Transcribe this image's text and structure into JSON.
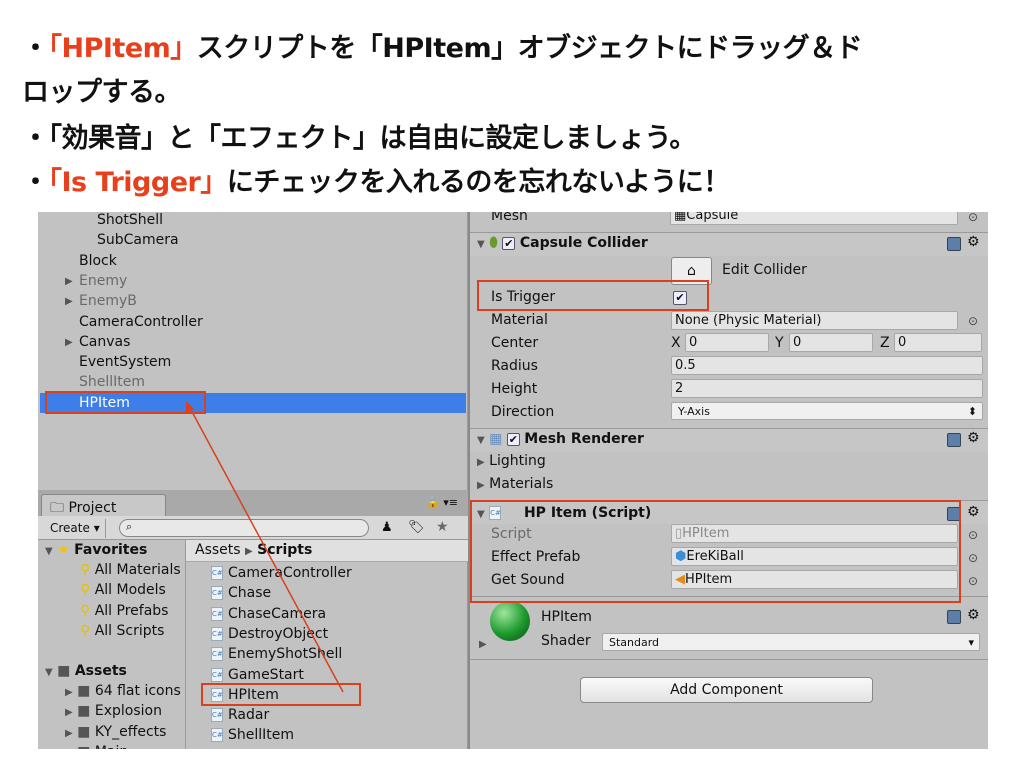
{
  "slide": {
    "lines": [
      {
        "bullet": "・",
        "parts": [
          {
            "text": "「HPItem」",
            "red": true
          },
          {
            "text": "スクリプトを「HPItem」オブジェクトにドラッグ＆ド",
            "red": false
          }
        ]
      },
      {
        "bullet": "",
        "parts": [
          {
            "text": "ロップする。",
            "red": false
          }
        ]
      },
      {
        "bullet": "・",
        "parts": [
          {
            "text": "「効果音」と「エフェクト」は自由に設定しましょう。",
            "red": false
          }
        ]
      },
      {
        "bullet": "・",
        "parts": [
          {
            "text": "「Is Trigger」",
            "red": true
          },
          {
            "text": "にチェックを入れるのを忘れないように！",
            "red": false
          }
        ]
      }
    ],
    "accent": "#e8401c"
  },
  "hierarchy": {
    "items": [
      {
        "label": "ShotShell",
        "indent": 2,
        "gray": false,
        "arrow": false
      },
      {
        "label": "SubCamera",
        "indent": 2,
        "gray": false,
        "arrow": false
      },
      {
        "label": "Block",
        "indent": 1,
        "gray": false,
        "arrow": false
      },
      {
        "label": "Enemy",
        "indent": 1,
        "gray": true,
        "arrow": true
      },
      {
        "label": "EnemyB",
        "indent": 1,
        "gray": true,
        "arrow": true
      },
      {
        "label": "CameraController",
        "indent": 1,
        "gray": false,
        "arrow": false
      },
      {
        "label": "Canvas",
        "indent": 1,
        "gray": false,
        "arrow": true
      },
      {
        "label": "EventSystem",
        "indent": 1,
        "gray": false,
        "arrow": false
      },
      {
        "label": "ShellItem",
        "indent": 1,
        "gray": true,
        "arrow": false
      },
      {
        "label": "HPItem",
        "indent": 1,
        "gray": false,
        "arrow": false,
        "selected": true
      }
    ],
    "selected_color": "#3d7ee8"
  },
  "project": {
    "tab": "Project",
    "create": "Create",
    "search_placeholder": "",
    "favorites": {
      "label": "Favorites",
      "items": [
        "All Materials",
        "All Models",
        "All Prefabs",
        "All Scripts"
      ]
    },
    "assets": {
      "label": "Assets",
      "items": [
        "64 flat icons",
        "Explosion",
        "KY_effects",
        "Main"
      ]
    },
    "breadcrumb": [
      "Assets",
      "Scripts"
    ],
    "scripts": [
      "CameraController",
      "Chase",
      "ChaseCamera",
      "DestroyObject",
      "EnemyShotShell",
      "GameStart",
      "HPItem",
      "Radar",
      "ShellItem"
    ]
  },
  "inspector": {
    "mesh": {
      "label": "Mesh",
      "value": "Capsule"
    },
    "capsule": {
      "title": "Capsule Collider",
      "edit": "Edit Collider",
      "is_trigger": "Is Trigger",
      "is_trigger_checked": true,
      "material_label": "Material",
      "material": "None (Physic Material)",
      "center_label": "Center",
      "x": "0",
      "y": "0",
      "z": "0",
      "xl": "X",
      "yl": "Y",
      "zl": "Z",
      "radius_label": "Radius",
      "radius": "0.5",
      "height_label": "Height",
      "height": "2",
      "direction_label": "Direction",
      "direction": "Y-Axis"
    },
    "renderer": {
      "title": "Mesh Renderer",
      "lighting": "Lighting",
      "materials": "Materials"
    },
    "script": {
      "title": "HP Item (Script)",
      "script_label": "Script",
      "script": "HPItem",
      "effect_label": "Effect Prefab",
      "effect": "EreKiBall",
      "sound_label": "Get Sound",
      "sound": "HPItem"
    },
    "material": {
      "name": "HPItem",
      "shader_label": "Shader",
      "shader": "Standard"
    },
    "add_component": "Add Component"
  }
}
